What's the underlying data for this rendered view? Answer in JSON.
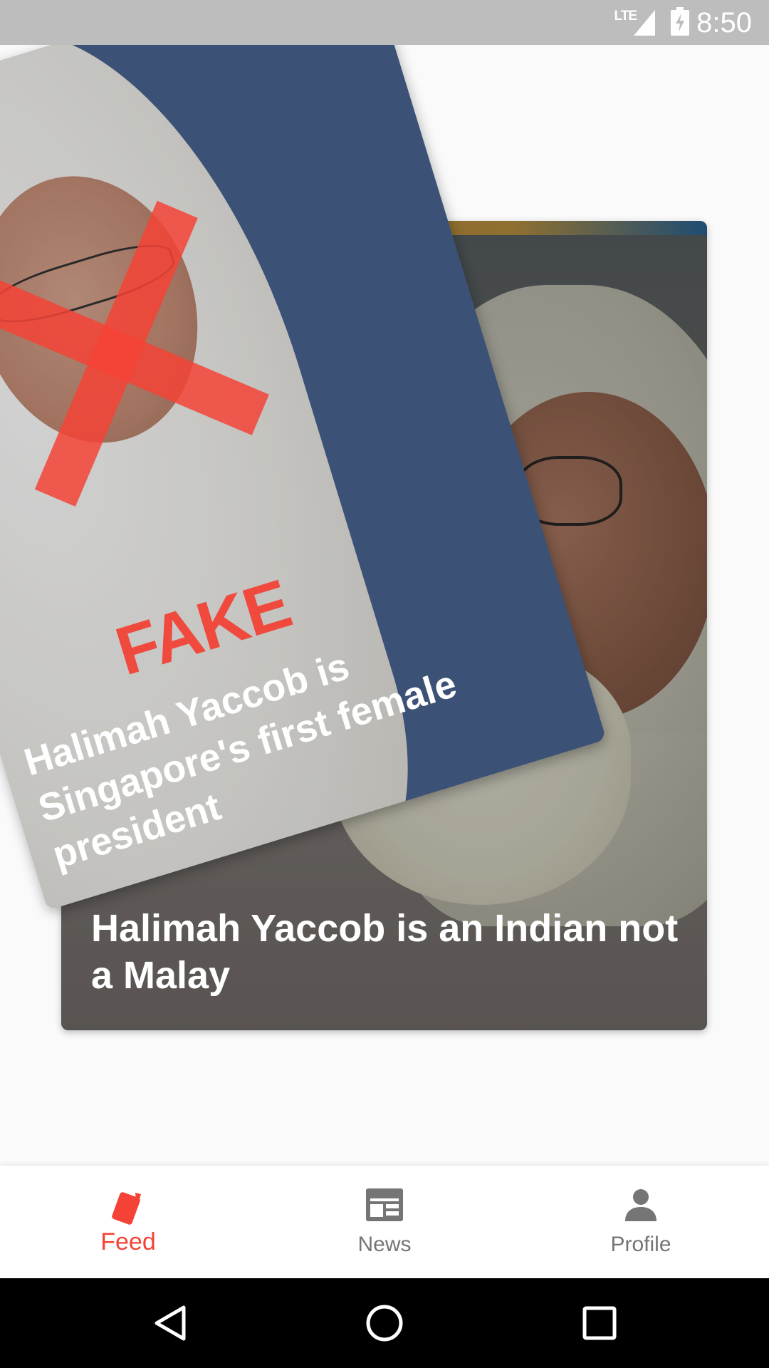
{
  "status_bar": {
    "network": "LTE",
    "time": "8:50"
  },
  "cards": {
    "front": {
      "verdict": "FAKE",
      "title": "Halimah Yaccob is Singapore's first female president"
    },
    "back": {
      "title": "Halimah Yaccob is an Indian not a Malay"
    }
  },
  "bottom_nav": {
    "items": [
      {
        "label": "Feed",
        "icon": "cards-icon",
        "active": true
      },
      {
        "label": "News",
        "icon": "newspaper-icon",
        "active": false
      },
      {
        "label": "Profile",
        "icon": "person-icon",
        "active": false
      }
    ]
  },
  "system_nav": {
    "buttons": [
      "back",
      "home",
      "recents"
    ]
  },
  "colors": {
    "accent": "#f44336",
    "nav_inactive": "#757575",
    "fake_red": "#f04a3e"
  }
}
